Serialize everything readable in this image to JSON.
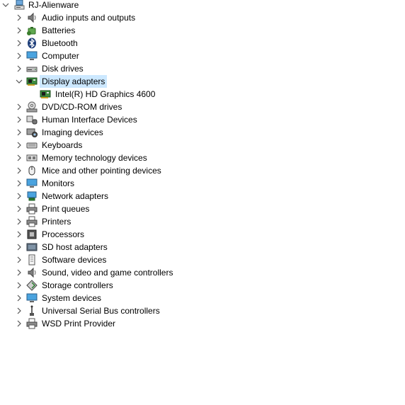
{
  "tree": {
    "root": {
      "label": "RJ-Alienware",
      "icon": "computer-icon",
      "expanded": true
    },
    "categories": [
      {
        "label": "Audio inputs and outputs",
        "icon": "speaker-icon"
      },
      {
        "label": "Batteries",
        "icon": "battery-icon"
      },
      {
        "label": "Bluetooth",
        "icon": "bluetooth-icon"
      },
      {
        "label": "Computer",
        "icon": "monitor-icon"
      },
      {
        "label": "Disk drives",
        "icon": "disk-drive-icon"
      },
      {
        "label": "Display adapters",
        "icon": "display-adapter-icon",
        "expanded": true,
        "selected": true,
        "children": [
          {
            "label": "Intel(R) HD Graphics 4600",
            "icon": "display-adapter-icon"
          }
        ]
      },
      {
        "label": "DVD/CD-ROM drives",
        "icon": "optical-drive-icon"
      },
      {
        "label": "Human Interface Devices",
        "icon": "hid-icon"
      },
      {
        "label": "Imaging devices",
        "icon": "camera-icon"
      },
      {
        "label": "Keyboards",
        "icon": "keyboard-icon"
      },
      {
        "label": "Memory technology devices",
        "icon": "memory-icon"
      },
      {
        "label": "Mice and other pointing devices",
        "icon": "mouse-icon"
      },
      {
        "label": "Monitors",
        "icon": "monitor-icon"
      },
      {
        "label": "Network adapters",
        "icon": "network-icon"
      },
      {
        "label": "Print queues",
        "icon": "printer-icon"
      },
      {
        "label": "Printers",
        "icon": "printer-icon"
      },
      {
        "label": "Processors",
        "icon": "processor-icon"
      },
      {
        "label": "SD host adapters",
        "icon": "sd-card-icon"
      },
      {
        "label": "Software devices",
        "icon": "software-device-icon"
      },
      {
        "label": "Sound, video and game controllers",
        "icon": "speaker-icon"
      },
      {
        "label": "Storage controllers",
        "icon": "storage-controller-icon"
      },
      {
        "label": "System devices",
        "icon": "monitor-icon"
      },
      {
        "label": "Universal Serial Bus controllers",
        "icon": "usb-icon"
      },
      {
        "label": "WSD Print Provider",
        "icon": "printer-icon"
      }
    ]
  },
  "colors": {
    "selection": "#cce8ff",
    "chevron": "#555555",
    "text": "#000000"
  }
}
